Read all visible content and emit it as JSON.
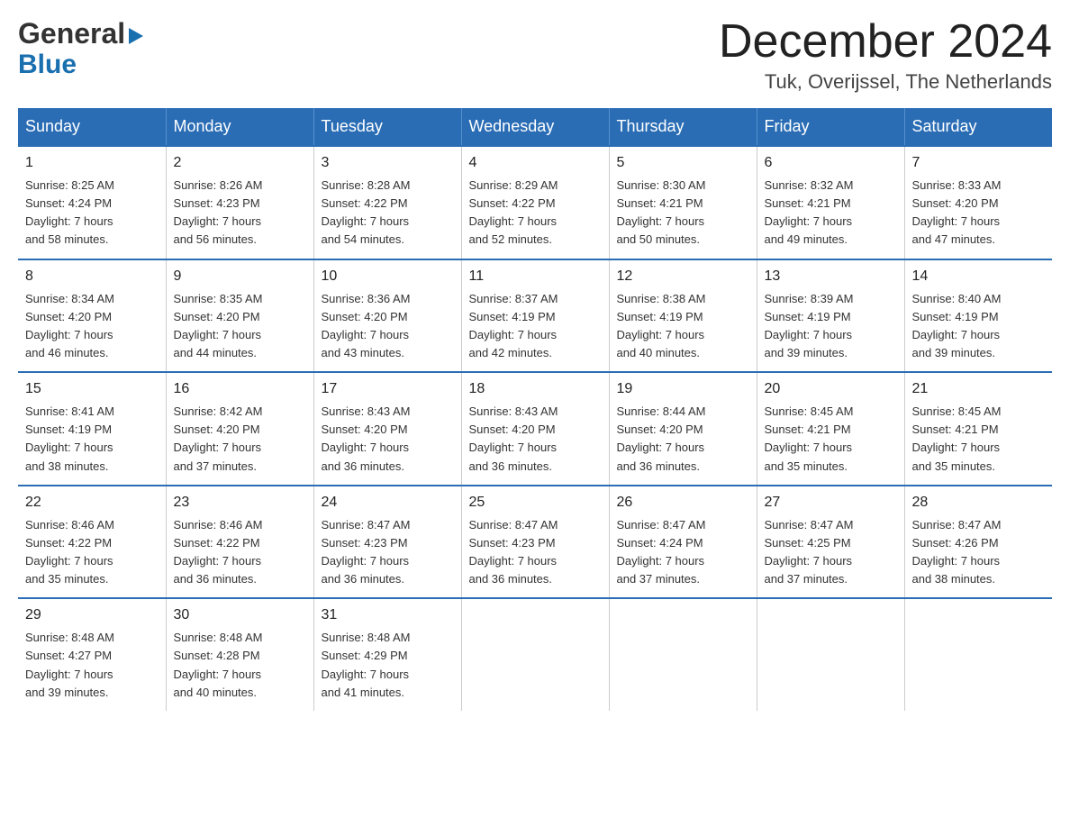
{
  "header": {
    "logo_line1": "General",
    "logo_line2": "Blue",
    "month_title": "December 2024",
    "location": "Tuk, Overijssel, The Netherlands"
  },
  "weekdays": [
    "Sunday",
    "Monday",
    "Tuesday",
    "Wednesday",
    "Thursday",
    "Friday",
    "Saturday"
  ],
  "weeks": [
    {
      "days": [
        {
          "num": "1",
          "info": "Sunrise: 8:25 AM\nSunset: 4:24 PM\nDaylight: 7 hours\nand 58 minutes."
        },
        {
          "num": "2",
          "info": "Sunrise: 8:26 AM\nSunset: 4:23 PM\nDaylight: 7 hours\nand 56 minutes."
        },
        {
          "num": "3",
          "info": "Sunrise: 8:28 AM\nSunset: 4:22 PM\nDaylight: 7 hours\nand 54 minutes."
        },
        {
          "num": "4",
          "info": "Sunrise: 8:29 AM\nSunset: 4:22 PM\nDaylight: 7 hours\nand 52 minutes."
        },
        {
          "num": "5",
          "info": "Sunrise: 8:30 AM\nSunset: 4:21 PM\nDaylight: 7 hours\nand 50 minutes."
        },
        {
          "num": "6",
          "info": "Sunrise: 8:32 AM\nSunset: 4:21 PM\nDaylight: 7 hours\nand 49 minutes."
        },
        {
          "num": "7",
          "info": "Sunrise: 8:33 AM\nSunset: 4:20 PM\nDaylight: 7 hours\nand 47 minutes."
        }
      ]
    },
    {
      "days": [
        {
          "num": "8",
          "info": "Sunrise: 8:34 AM\nSunset: 4:20 PM\nDaylight: 7 hours\nand 46 minutes."
        },
        {
          "num": "9",
          "info": "Sunrise: 8:35 AM\nSunset: 4:20 PM\nDaylight: 7 hours\nand 44 minutes."
        },
        {
          "num": "10",
          "info": "Sunrise: 8:36 AM\nSunset: 4:20 PM\nDaylight: 7 hours\nand 43 minutes."
        },
        {
          "num": "11",
          "info": "Sunrise: 8:37 AM\nSunset: 4:19 PM\nDaylight: 7 hours\nand 42 minutes."
        },
        {
          "num": "12",
          "info": "Sunrise: 8:38 AM\nSunset: 4:19 PM\nDaylight: 7 hours\nand 40 minutes."
        },
        {
          "num": "13",
          "info": "Sunrise: 8:39 AM\nSunset: 4:19 PM\nDaylight: 7 hours\nand 39 minutes."
        },
        {
          "num": "14",
          "info": "Sunrise: 8:40 AM\nSunset: 4:19 PM\nDaylight: 7 hours\nand 39 minutes."
        }
      ]
    },
    {
      "days": [
        {
          "num": "15",
          "info": "Sunrise: 8:41 AM\nSunset: 4:19 PM\nDaylight: 7 hours\nand 38 minutes."
        },
        {
          "num": "16",
          "info": "Sunrise: 8:42 AM\nSunset: 4:20 PM\nDaylight: 7 hours\nand 37 minutes."
        },
        {
          "num": "17",
          "info": "Sunrise: 8:43 AM\nSunset: 4:20 PM\nDaylight: 7 hours\nand 36 minutes."
        },
        {
          "num": "18",
          "info": "Sunrise: 8:43 AM\nSunset: 4:20 PM\nDaylight: 7 hours\nand 36 minutes."
        },
        {
          "num": "19",
          "info": "Sunrise: 8:44 AM\nSunset: 4:20 PM\nDaylight: 7 hours\nand 36 minutes."
        },
        {
          "num": "20",
          "info": "Sunrise: 8:45 AM\nSunset: 4:21 PM\nDaylight: 7 hours\nand 35 minutes."
        },
        {
          "num": "21",
          "info": "Sunrise: 8:45 AM\nSunset: 4:21 PM\nDaylight: 7 hours\nand 35 minutes."
        }
      ]
    },
    {
      "days": [
        {
          "num": "22",
          "info": "Sunrise: 8:46 AM\nSunset: 4:22 PM\nDaylight: 7 hours\nand 35 minutes."
        },
        {
          "num": "23",
          "info": "Sunrise: 8:46 AM\nSunset: 4:22 PM\nDaylight: 7 hours\nand 36 minutes."
        },
        {
          "num": "24",
          "info": "Sunrise: 8:47 AM\nSunset: 4:23 PM\nDaylight: 7 hours\nand 36 minutes."
        },
        {
          "num": "25",
          "info": "Sunrise: 8:47 AM\nSunset: 4:23 PM\nDaylight: 7 hours\nand 36 minutes."
        },
        {
          "num": "26",
          "info": "Sunrise: 8:47 AM\nSunset: 4:24 PM\nDaylight: 7 hours\nand 37 minutes."
        },
        {
          "num": "27",
          "info": "Sunrise: 8:47 AM\nSunset: 4:25 PM\nDaylight: 7 hours\nand 37 minutes."
        },
        {
          "num": "28",
          "info": "Sunrise: 8:47 AM\nSunset: 4:26 PM\nDaylight: 7 hours\nand 38 minutes."
        }
      ]
    },
    {
      "days": [
        {
          "num": "29",
          "info": "Sunrise: 8:48 AM\nSunset: 4:27 PM\nDaylight: 7 hours\nand 39 minutes."
        },
        {
          "num": "30",
          "info": "Sunrise: 8:48 AM\nSunset: 4:28 PM\nDaylight: 7 hours\nand 40 minutes."
        },
        {
          "num": "31",
          "info": "Sunrise: 8:48 AM\nSunset: 4:29 PM\nDaylight: 7 hours\nand 41 minutes."
        },
        {
          "num": "",
          "info": ""
        },
        {
          "num": "",
          "info": ""
        },
        {
          "num": "",
          "info": ""
        },
        {
          "num": "",
          "info": ""
        }
      ]
    }
  ]
}
